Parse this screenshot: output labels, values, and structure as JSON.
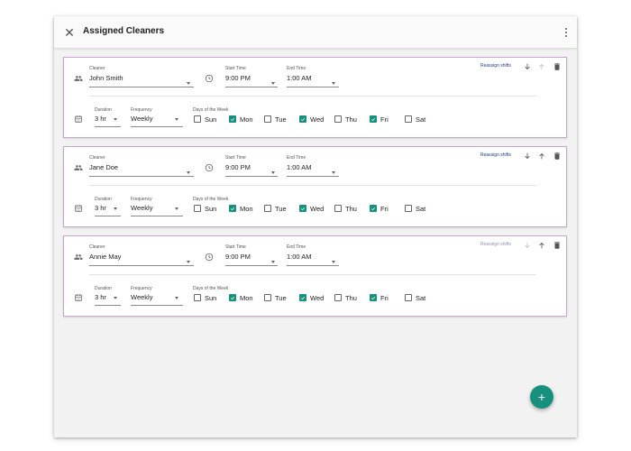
{
  "header": {
    "title": "Assigned Cleaners",
    "close_icon": "close-icon",
    "more_icon": "more-vert-icon"
  },
  "labels": {
    "cleaner": "Cleaner",
    "start_time": "Start Time",
    "end_time": "End Time",
    "duration": "Duration",
    "frequency": "Frequency",
    "days_of_week": "Days of the Week",
    "reassign": "Reassign shifts"
  },
  "days": [
    "Sun",
    "Mon",
    "Tue",
    "Wed",
    "Thu",
    "Fri",
    "Sat"
  ],
  "cards": [
    {
      "cleaner": "John Smith",
      "start_time": "9:00 PM",
      "end_time": "1:00 AM",
      "duration": "3 hr",
      "frequency": "Weekly",
      "days_checked": [
        false,
        true,
        false,
        true,
        false,
        true,
        false
      ],
      "reassign_enabled": true,
      "move_down_enabled": true,
      "move_up_enabled": false
    },
    {
      "cleaner": "Jane Doe",
      "start_time": "9:00 PM",
      "end_time": "1:00 AM",
      "duration": "3 hr",
      "frequency": "Weekly",
      "days_checked": [
        false,
        true,
        false,
        true,
        false,
        true,
        false
      ],
      "reassign_enabled": true,
      "move_down_enabled": true,
      "move_up_enabled": true
    },
    {
      "cleaner": "Annie May",
      "start_time": "9:00 PM",
      "end_time": "1:00 AM",
      "duration": "3 hr",
      "frequency": "Weekly",
      "days_checked": [
        false,
        true,
        false,
        true,
        false,
        true,
        false
      ],
      "reassign_enabled": false,
      "move_down_enabled": false,
      "move_up_enabled": true
    }
  ],
  "fab": {
    "label": "+",
    "icon": "add-icon"
  },
  "colors": {
    "accent": "#17907e",
    "card_border": "#c9a4cf",
    "link": "#1a3e8c",
    "background": "#f2f2f2"
  }
}
